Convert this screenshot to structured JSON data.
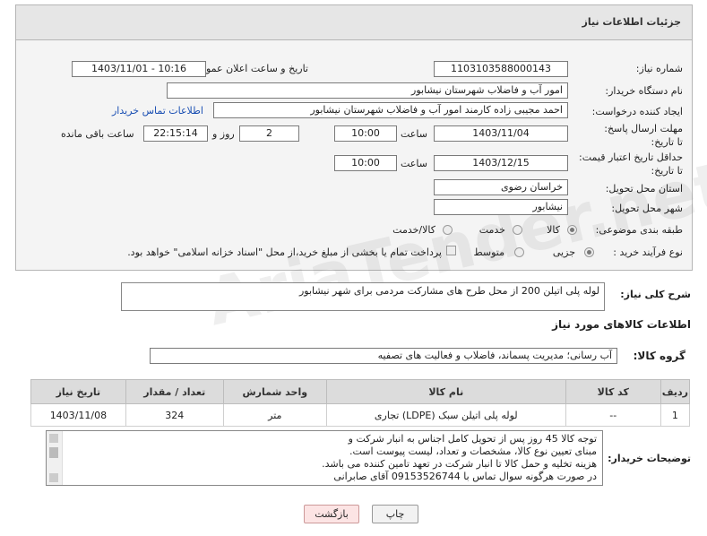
{
  "header": {
    "title": "جزئیات اطلاعات نیاز"
  },
  "form": {
    "need_number_label": "شماره نیاز:",
    "need_number": "1103103588000143",
    "announce_label": "تاریخ و ساعت اعلان عمومی:",
    "announce_value": "1403/11/01 - 10:16",
    "buyer_label": "نام دستگاه خریدار:",
    "buyer_value": "امور آب و فاضلاب شهرستان نیشابور",
    "creator_label": "ایجاد کننده درخواست:",
    "creator_value": "احمد مجیبی زاده کارمند امور آب و فاضلاب شهرستان نیشابور",
    "contact_link": "اطلاعات تماس خریدار",
    "deadline_label": "مهلت ارسال پاسخ: تا تاریخ:",
    "deadline_date": "1403/11/04",
    "time_label": "ساعت",
    "deadline_time": "10:00",
    "days_value": "2",
    "days_label": "روز و",
    "remaining_time": "22:15:14",
    "remaining_label": "ساعت باقی مانده",
    "min_validity_label": "حداقل تاریخ اعتبار قیمت: تا تاریخ:",
    "validity_date": "1403/12/15",
    "validity_time": "10:00",
    "province_label": "استان محل تحویل:",
    "province_value": "خراسان رضوی",
    "city_label": "شهر محل تحویل:",
    "city_value": "نیشابور",
    "category_label": "طبقه بندی موضوعی:",
    "category_options": [
      "کالا",
      "خدمت",
      "کالا/خدمت"
    ],
    "process_label": "نوع فرآیند خرید :",
    "process_options": [
      "جزیی",
      "متوسط"
    ],
    "payment_note": "پرداخت تمام یا بخشی از مبلغ خرید،از محل \"اسناد خزانه اسلامی\" خواهد بود."
  },
  "description": {
    "label": "شرح کلی نیاز:",
    "value": "لوله پلی اتیلن 200 از محل طرح های مشارکت مردمی برای شهر نیشابور"
  },
  "goods_section": {
    "title": "اطلاعات کالاهای مورد نیاز"
  },
  "goods_group": {
    "label": "گروه کالا:",
    "value": "آب رسانی؛ مدیریت پسماند، فاضلاب و فعالیت های تصفیه"
  },
  "table": {
    "headers": [
      "ردیف",
      "کد کالا",
      "نام کالا",
      "واحد شمارش",
      "تعداد / مقدار",
      "تاریخ نیاز"
    ],
    "rows": [
      [
        "1",
        "--",
        "لوله پلی اتیلن سبک (LDPE) تجاری",
        "متر",
        "324",
        "1403/11/08"
      ]
    ]
  },
  "buyer_notes": {
    "label": "توضیحات خریدار:",
    "lines": [
      "توجه کالا 45 روز پس از تحویل کامل اجناس به انبار شرکت و",
      "مبنای تعیین نوع کالا، مشخصات و تعداد، لیست پیوست است.",
      "هزینه تخلیه و حمل کالا تا انبار شرکت در تعهد تامین کننده می باشد.",
      "در صورت هرگونه سوال تماس با 09153526744 آقای صابرانی"
    ]
  },
  "buttons": {
    "print": "چاپ",
    "back": "بازگشت"
  },
  "watermark": "AriaTender.net",
  "colors": {
    "link": "#1a4fb3",
    "header_bg": "#e6e6e6",
    "back_btn_bg": "#fce4e4"
  }
}
